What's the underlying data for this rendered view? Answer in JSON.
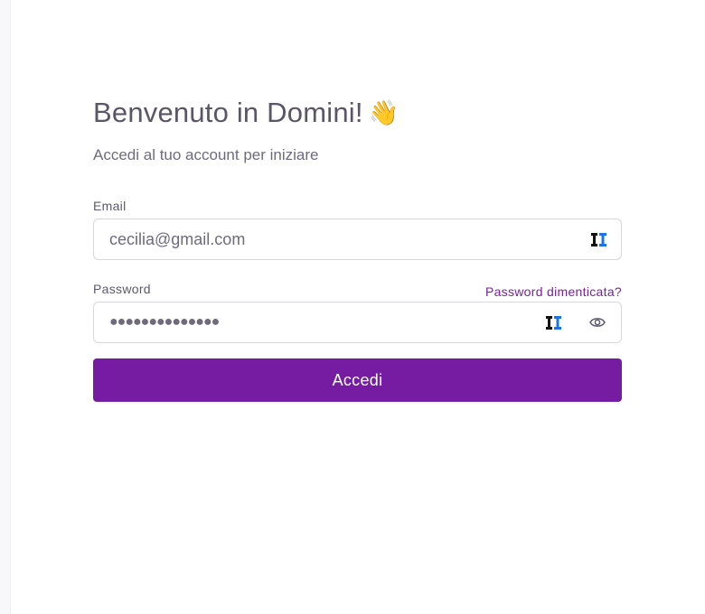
{
  "login": {
    "title": "Benvenuto in Domini!",
    "title_emoji": "👋",
    "subtitle": "Accedi al tuo account per iniziare",
    "email": {
      "label": "Email",
      "value": "cecilia@gmail.com",
      "autofill_icon": "password-manager-icon"
    },
    "password": {
      "label": "Password",
      "forgot_link": "Password dimenticata?",
      "masked_value": "●●●●●●●●●●●●●●",
      "autofill_icon": "password-manager-icon",
      "toggle_icon": "eye-icon"
    },
    "submit_label": "Accedi"
  },
  "colors": {
    "primary": "#751ca2",
    "text": "#5d596c",
    "border": "#d8d6de"
  }
}
